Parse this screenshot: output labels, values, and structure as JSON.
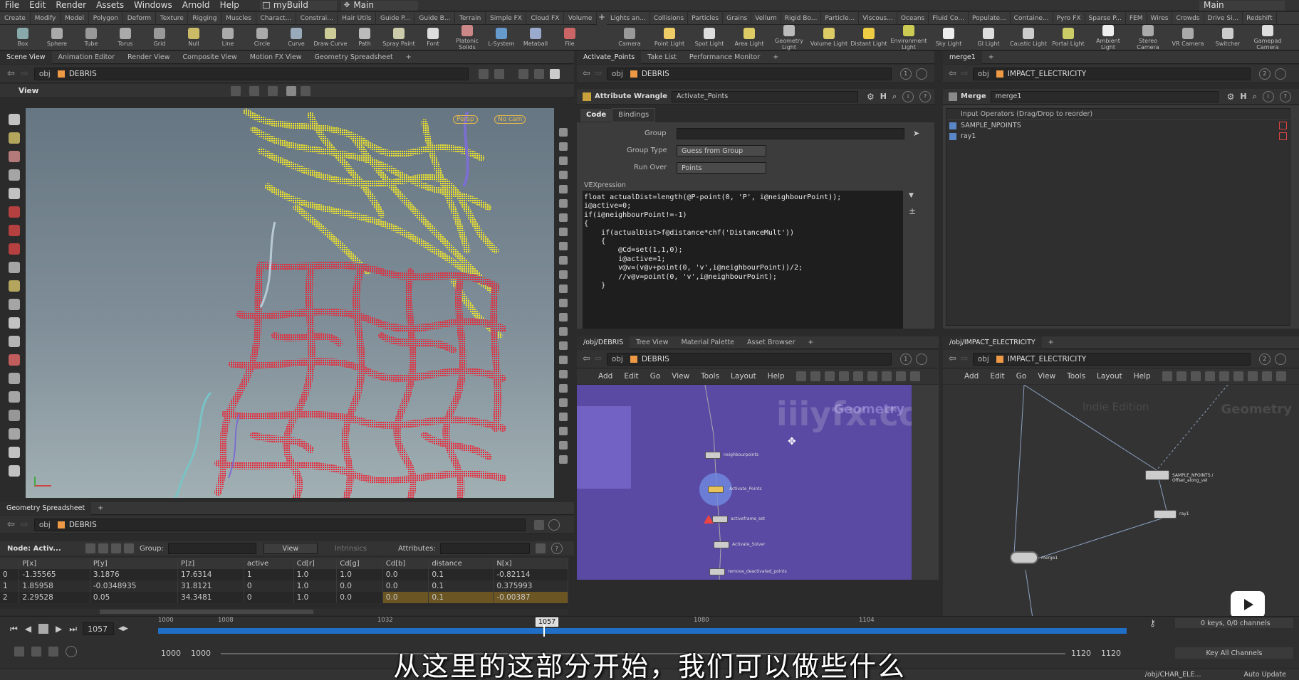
{
  "menubar": {
    "items": [
      "File",
      "Edit",
      "Render",
      "Assets",
      "Windows",
      "Arnold",
      "Help"
    ],
    "build": "myBuild",
    "desktop": "Main",
    "desktop_right": "Main"
  },
  "shelf_left_tabs": [
    "Create",
    "Modify",
    "Model",
    "Polygon",
    "Deform",
    "Texture",
    "Rigging",
    "Muscles",
    "Charact...",
    "Constrai...",
    "Hair Utils",
    "Guide P...",
    "Guide B...",
    "Terrain",
    "Simple FX",
    "Cloud FX",
    "Volume"
  ],
  "shelf_right_tabs": [
    "Lights an...",
    "Collisions",
    "Particles",
    "Grains",
    "Vellum",
    "Rigid Bo...",
    "Particle...",
    "Viscous...",
    "Oceans",
    "Fluid Co...",
    "Populate...",
    "Containe...",
    "Pyro FX",
    "Sparse P...",
    "FEM",
    "Wires",
    "Crowds",
    "Drive Si...",
    "Redshift"
  ],
  "shelf_left_tools": [
    {
      "label": "Box",
      "color": "#8aa"
    },
    {
      "label": "Sphere",
      "color": "#aaa"
    },
    {
      "label": "Tube",
      "color": "#999"
    },
    {
      "label": "Torus",
      "color": "#aaa"
    },
    {
      "label": "Grid",
      "color": "#999"
    },
    {
      "label": "Null",
      "color": "#cb6"
    },
    {
      "label": "Line",
      "color": "#aaa"
    },
    {
      "label": "Circle",
      "color": "#aaa"
    },
    {
      "label": "Curve",
      "color": "#9ab"
    },
    {
      "label": "Draw Curve",
      "color": "#cc9"
    },
    {
      "label": "Path",
      "color": "#bbb"
    },
    {
      "label": "Spray Paint",
      "color": "#cca"
    },
    {
      "label": "Font",
      "color": "#ddd"
    },
    {
      "label": "Platonic Solids",
      "color": "#c88"
    },
    {
      "label": "L-System",
      "color": "#69c"
    },
    {
      "label": "Metaball",
      "color": "#9ac"
    },
    {
      "label": "File",
      "color": "#c66"
    }
  ],
  "shelf_right_tools": [
    {
      "label": "Camera",
      "color": "#999"
    },
    {
      "label": "Point Light",
      "color": "#ec6"
    },
    {
      "label": "Spot Light",
      "color": "#ddd"
    },
    {
      "label": "Area Light",
      "color": "#dc6"
    },
    {
      "label": "Geometry Light",
      "color": "#bbb"
    },
    {
      "label": "Volume Light",
      "color": "#dc6"
    },
    {
      "label": "Distant Light",
      "color": "#ec4"
    },
    {
      "label": "Environment Light",
      "color": "#cc5"
    },
    {
      "label": "Sky Light",
      "color": "#eee"
    },
    {
      "label": "GI Light",
      "color": "#ddd"
    },
    {
      "label": "Caustic Light",
      "color": "#ccc"
    },
    {
      "label": "Portal Light",
      "color": "#cc6"
    },
    {
      "label": "Ambient Light",
      "color": "#eee"
    },
    {
      "label": "Stereo Camera",
      "color": "#aaa"
    },
    {
      "label": "VR Camera",
      "color": "#aaa"
    },
    {
      "label": "Switcher",
      "color": "#ccc"
    },
    {
      "label": "Gamepad Camera",
      "color": "#ddd"
    }
  ],
  "viewport_pane": {
    "tabs": [
      "Scene View",
      "Animation Editor",
      "Render View",
      "Composite View",
      "Motion FX View",
      "Geometry Spreadsheet"
    ],
    "path_obj": "obj",
    "path_node": "DEBRIS",
    "view_label": "View",
    "persp": "Persp",
    "cam": "No cam"
  },
  "wrangle_pane": {
    "tabs": [
      "Activate_Points",
      "Take List",
      "Performance Monitor"
    ],
    "path_obj": "obj",
    "path_node": "DEBRIS",
    "node_type": "Attribute Wrangle",
    "node_name": "Activate_Points",
    "subtabs": [
      "Code",
      "Bindings"
    ],
    "group_label": "Group",
    "group_value": "",
    "group_type_label": "Group Type",
    "group_type_value": "Guess from Group",
    "run_over_label": "Run Over",
    "run_over_value": "Points",
    "vex_label": "VEXpression",
    "code_lines": [
      "float actualDist=length(@P-point(0, 'P', i@neighbourPoint));",
      "i@active=0;",
      "if(i@neighbourPoint!=-1)",
      "{",
      "",
      "    if(actualDist>f@distance*chf('DistanceMult'))",
      "    {",
      "",
      "        @Cd=set(1,1,0);",
      "        i@active=1;",
      "        v@v=(v@v+point(0, 'v',i@neighbourPoint))/2;",
      "        //v@v=point(0, 'v',i@neighbourPoint);",
      "    }"
    ]
  },
  "merge_pane": {
    "tab": "merge1",
    "path_obj": "obj",
    "path_node": "IMPACT_ELECTRICITY",
    "node_type": "Merge",
    "node_name": "merge1",
    "input_header": "Input Operators (Drag/Drop to reorder)",
    "inputs": [
      "SAMPLE_NPOINTS",
      "ray1"
    ]
  },
  "network_left": {
    "tabs": [
      "/obj/DEBRIS",
      "Tree View",
      "Material Palette",
      "Asset Browser"
    ],
    "path_obj": "obj",
    "path_node": "DEBRIS",
    "menu": [
      "Add",
      "Edit",
      "Go",
      "View",
      "Tools",
      "Layout",
      "Help"
    ],
    "context": "Geometry",
    "nodes": [
      "neighbourpoints",
      "Activate_Points",
      "activeframe_set",
      "Activate_Solver",
      "remove_deactivated_points"
    ]
  },
  "network_right": {
    "tabs": [
      "/obj/IMPACT_ELECTRICITY"
    ],
    "path_obj": "obj",
    "path_node": "IMPACT_ELECTRICITY",
    "menu": [
      "Add",
      "Edit",
      "Go",
      "View",
      "Tools",
      "Layout",
      "Help"
    ],
    "edition": "Indie Edition",
    "context": "Geometry",
    "nodes": [
      "SAMPLE_NPOINTS / Offset_along_vel",
      "ray1",
      "merge1"
    ]
  },
  "spreadsheet": {
    "tab": "Geometry Spreadsheet",
    "path_obj": "obj",
    "path_node": "DEBRIS",
    "node_label": "Node: Activ...",
    "group_label": "Group:",
    "view_label": "View",
    "intrinsics_label": "Intrinsics",
    "attributes_label": "Attributes:",
    "columns": [
      "",
      "P[x]",
      "P[y]",
      "P[z]",
      "active",
      "Cd[r]",
      "Cd[g]",
      "Cd[b]",
      "distance",
      "N[x]"
    ],
    "rows": [
      [
        "0",
        "-1.35565",
        "3.1876",
        "17.6314",
        "1",
        "1.0",
        "1.0",
        "0.0",
        "0.1",
        "-0.82114"
      ],
      [
        "1",
        "1.85958",
        "-0.0348935",
        "31.8121",
        "0",
        "1.0",
        "0.0",
        "0.0",
        "0.1",
        "0.375993"
      ],
      [
        "2",
        "2.29528",
        "0.05",
        "34.3481",
        "0",
        "1.0",
        "0.0",
        "0.0",
        "0.1",
        "-0.00387"
      ]
    ]
  },
  "timeline": {
    "frame": "1057",
    "ticks": [
      "1000",
      "1008",
      "1032",
      "1057",
      "1080",
      "1104"
    ],
    "start": "1000",
    "start2": "1000",
    "end": "1120",
    "end2": "1120",
    "keys": "0 keys, 0/0 channels",
    "key_all": "Key All Channels",
    "path": "/obj/CHAR_ELE...",
    "auto_update": "Auto Update"
  },
  "watermark": "iiiyfx.com",
  "subtitle": "从这里的这部分开始，我们可以做些什么"
}
